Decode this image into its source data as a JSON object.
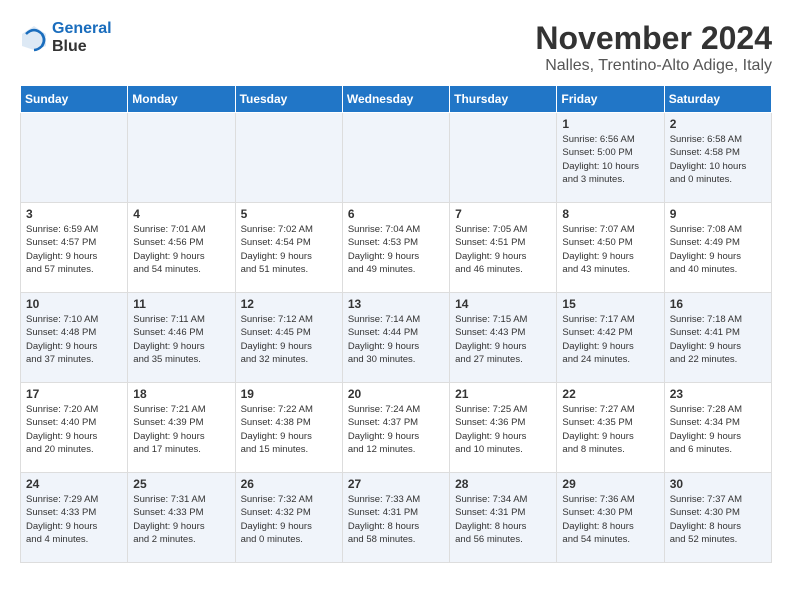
{
  "header": {
    "logo_line1": "General",
    "logo_line2": "Blue",
    "month": "November 2024",
    "location": "Nalles, Trentino-Alto Adige, Italy"
  },
  "weekdays": [
    "Sunday",
    "Monday",
    "Tuesday",
    "Wednesday",
    "Thursday",
    "Friday",
    "Saturday"
  ],
  "weeks": [
    [
      {
        "day": "",
        "info": ""
      },
      {
        "day": "",
        "info": ""
      },
      {
        "day": "",
        "info": ""
      },
      {
        "day": "",
        "info": ""
      },
      {
        "day": "",
        "info": ""
      },
      {
        "day": "1",
        "info": "Sunrise: 6:56 AM\nSunset: 5:00 PM\nDaylight: 10 hours\nand 3 minutes."
      },
      {
        "day": "2",
        "info": "Sunrise: 6:58 AM\nSunset: 4:58 PM\nDaylight: 10 hours\nand 0 minutes."
      }
    ],
    [
      {
        "day": "3",
        "info": "Sunrise: 6:59 AM\nSunset: 4:57 PM\nDaylight: 9 hours\nand 57 minutes."
      },
      {
        "day": "4",
        "info": "Sunrise: 7:01 AM\nSunset: 4:56 PM\nDaylight: 9 hours\nand 54 minutes."
      },
      {
        "day": "5",
        "info": "Sunrise: 7:02 AM\nSunset: 4:54 PM\nDaylight: 9 hours\nand 51 minutes."
      },
      {
        "day": "6",
        "info": "Sunrise: 7:04 AM\nSunset: 4:53 PM\nDaylight: 9 hours\nand 49 minutes."
      },
      {
        "day": "7",
        "info": "Sunrise: 7:05 AM\nSunset: 4:51 PM\nDaylight: 9 hours\nand 46 minutes."
      },
      {
        "day": "8",
        "info": "Sunrise: 7:07 AM\nSunset: 4:50 PM\nDaylight: 9 hours\nand 43 minutes."
      },
      {
        "day": "9",
        "info": "Sunrise: 7:08 AM\nSunset: 4:49 PM\nDaylight: 9 hours\nand 40 minutes."
      }
    ],
    [
      {
        "day": "10",
        "info": "Sunrise: 7:10 AM\nSunset: 4:48 PM\nDaylight: 9 hours\nand 37 minutes."
      },
      {
        "day": "11",
        "info": "Sunrise: 7:11 AM\nSunset: 4:46 PM\nDaylight: 9 hours\nand 35 minutes."
      },
      {
        "day": "12",
        "info": "Sunrise: 7:12 AM\nSunset: 4:45 PM\nDaylight: 9 hours\nand 32 minutes."
      },
      {
        "day": "13",
        "info": "Sunrise: 7:14 AM\nSunset: 4:44 PM\nDaylight: 9 hours\nand 30 minutes."
      },
      {
        "day": "14",
        "info": "Sunrise: 7:15 AM\nSunset: 4:43 PM\nDaylight: 9 hours\nand 27 minutes."
      },
      {
        "day": "15",
        "info": "Sunrise: 7:17 AM\nSunset: 4:42 PM\nDaylight: 9 hours\nand 24 minutes."
      },
      {
        "day": "16",
        "info": "Sunrise: 7:18 AM\nSunset: 4:41 PM\nDaylight: 9 hours\nand 22 minutes."
      }
    ],
    [
      {
        "day": "17",
        "info": "Sunrise: 7:20 AM\nSunset: 4:40 PM\nDaylight: 9 hours\nand 20 minutes."
      },
      {
        "day": "18",
        "info": "Sunrise: 7:21 AM\nSunset: 4:39 PM\nDaylight: 9 hours\nand 17 minutes."
      },
      {
        "day": "19",
        "info": "Sunrise: 7:22 AM\nSunset: 4:38 PM\nDaylight: 9 hours\nand 15 minutes."
      },
      {
        "day": "20",
        "info": "Sunrise: 7:24 AM\nSunset: 4:37 PM\nDaylight: 9 hours\nand 12 minutes."
      },
      {
        "day": "21",
        "info": "Sunrise: 7:25 AM\nSunset: 4:36 PM\nDaylight: 9 hours\nand 10 minutes."
      },
      {
        "day": "22",
        "info": "Sunrise: 7:27 AM\nSunset: 4:35 PM\nDaylight: 9 hours\nand 8 minutes."
      },
      {
        "day": "23",
        "info": "Sunrise: 7:28 AM\nSunset: 4:34 PM\nDaylight: 9 hours\nand 6 minutes."
      }
    ],
    [
      {
        "day": "24",
        "info": "Sunrise: 7:29 AM\nSunset: 4:33 PM\nDaylight: 9 hours\nand 4 minutes."
      },
      {
        "day": "25",
        "info": "Sunrise: 7:31 AM\nSunset: 4:33 PM\nDaylight: 9 hours\nand 2 minutes."
      },
      {
        "day": "26",
        "info": "Sunrise: 7:32 AM\nSunset: 4:32 PM\nDaylight: 9 hours\nand 0 minutes."
      },
      {
        "day": "27",
        "info": "Sunrise: 7:33 AM\nSunset: 4:31 PM\nDaylight: 8 hours\nand 58 minutes."
      },
      {
        "day": "28",
        "info": "Sunrise: 7:34 AM\nSunset: 4:31 PM\nDaylight: 8 hours\nand 56 minutes."
      },
      {
        "day": "29",
        "info": "Sunrise: 7:36 AM\nSunset: 4:30 PM\nDaylight: 8 hours\nand 54 minutes."
      },
      {
        "day": "30",
        "info": "Sunrise: 7:37 AM\nSunset: 4:30 PM\nDaylight: 8 hours\nand 52 minutes."
      }
    ]
  ]
}
